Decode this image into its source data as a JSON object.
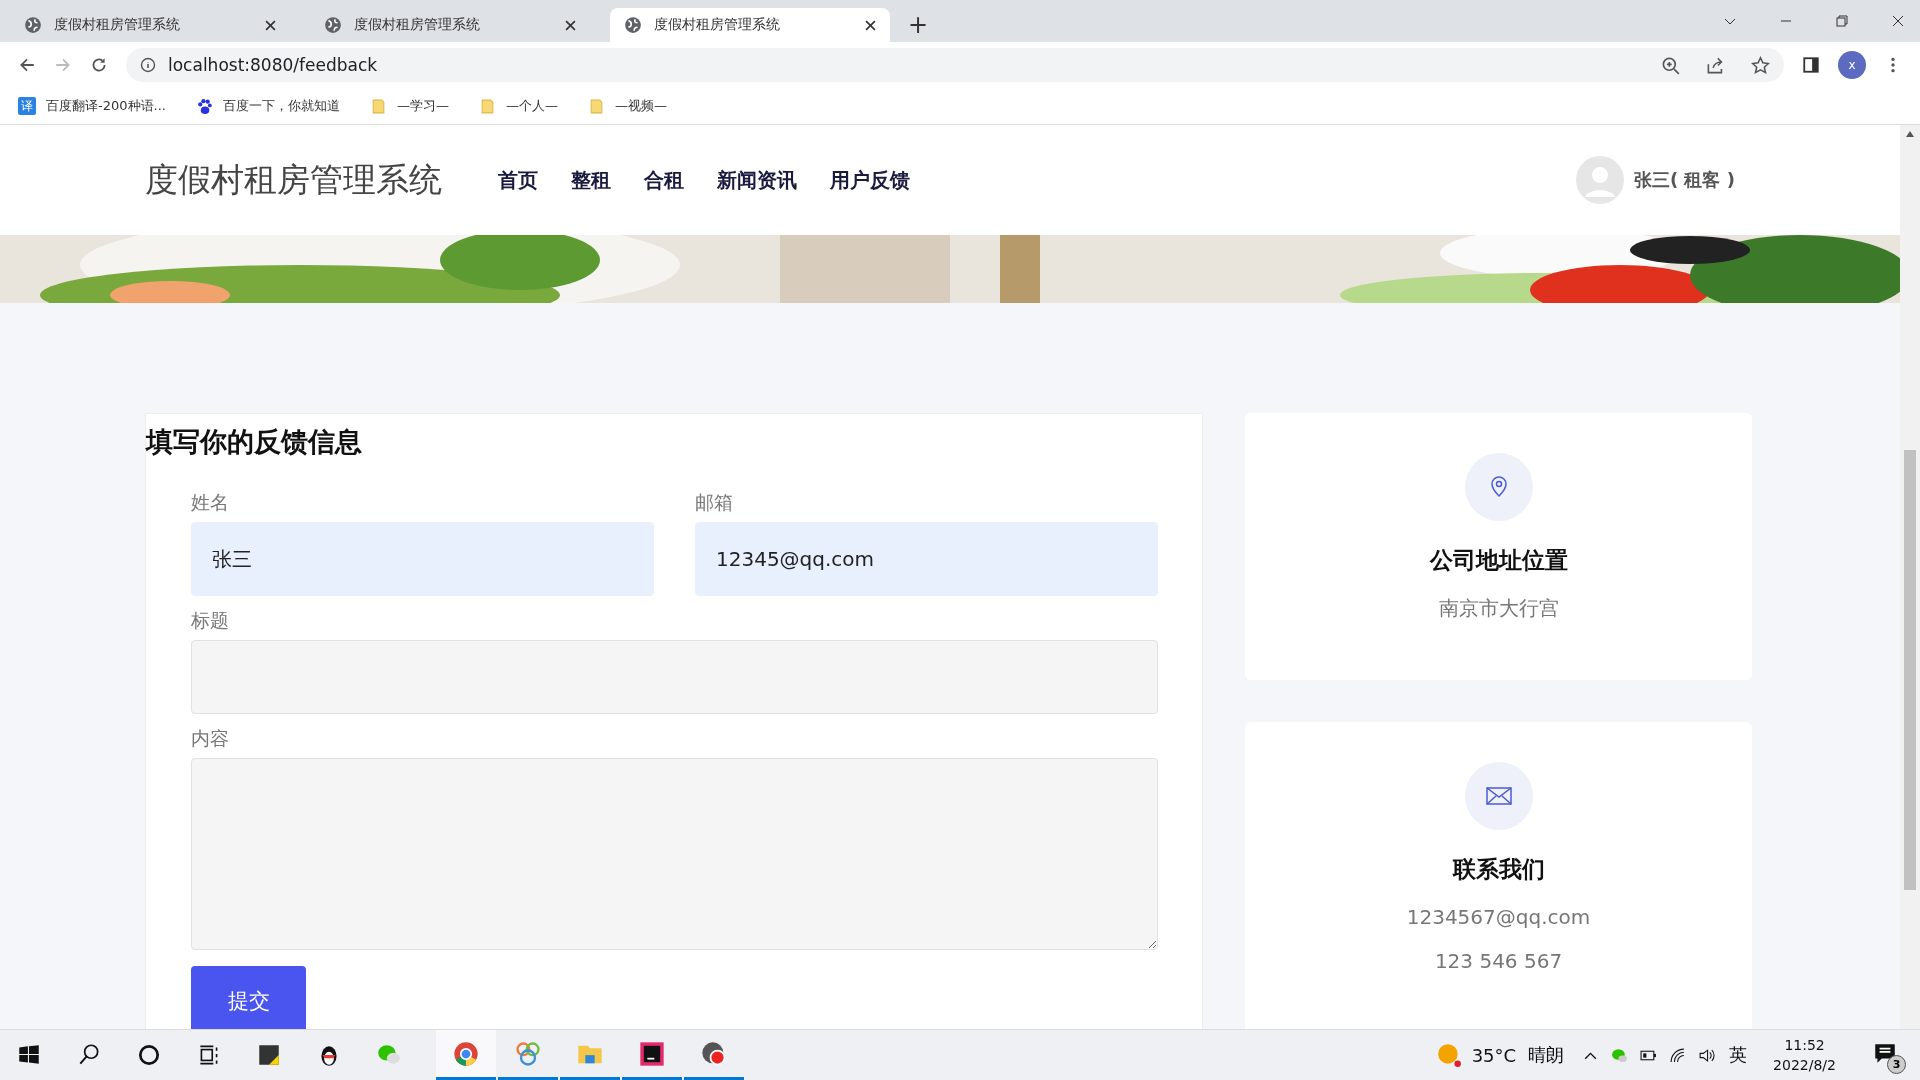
{
  "browser": {
    "tabs": [
      {
        "title": "度假村租房管理系统",
        "selected": false
      },
      {
        "title": "度假村租房管理系统",
        "selected": false
      },
      {
        "title": "度假村租房管理系统",
        "selected": true
      }
    ],
    "new_tab": "+",
    "url": "localhost:8080/feedback",
    "profile": "x",
    "bookmarks": [
      {
        "kind": "translate",
        "badge": "译",
        "label": "百度翻译-200种语..."
      },
      {
        "kind": "paw",
        "label": "百度一下，你就知道"
      },
      {
        "kind": "folder",
        "label": "—学习—"
      },
      {
        "kind": "folder",
        "label": "—个人—"
      },
      {
        "kind": "folder",
        "label": "—视频—"
      }
    ]
  },
  "site": {
    "logo": "度假村租房管理系统",
    "nav": [
      {
        "label": "首页"
      },
      {
        "label": "整租"
      },
      {
        "label": "合租"
      },
      {
        "label": "新闻资讯"
      },
      {
        "label": "用户反馈"
      }
    ],
    "user": "张三( 租客 )"
  },
  "form": {
    "title": "填写你的反馈信息",
    "fields": [
      {
        "label": "姓名",
        "value": "张三",
        "autofilled": true,
        "kind": "input"
      },
      {
        "label": "邮箱",
        "value": "12345@qq.com",
        "autofilled": true,
        "kind": "input"
      },
      {
        "label": "标题",
        "autofilled": false,
        "kind": "input"
      },
      {
        "label": "内容",
        "autofilled": false,
        "kind": "textarea"
      }
    ],
    "submit": "提交"
  },
  "info_cards": [
    {
      "kind": "location",
      "title": "公司地址位置",
      "lines": [
        "南京市大行宫"
      ]
    },
    {
      "kind": "mail",
      "title": "联系我们",
      "lines": [
        "1234567@qq.com",
        "123 546 567"
      ]
    }
  ],
  "taskbar": {
    "weather": "35°C",
    "condition": "晴朗",
    "ime": "英",
    "time": "11:52",
    "date": "2022/8/2",
    "notifications": "3"
  }
}
